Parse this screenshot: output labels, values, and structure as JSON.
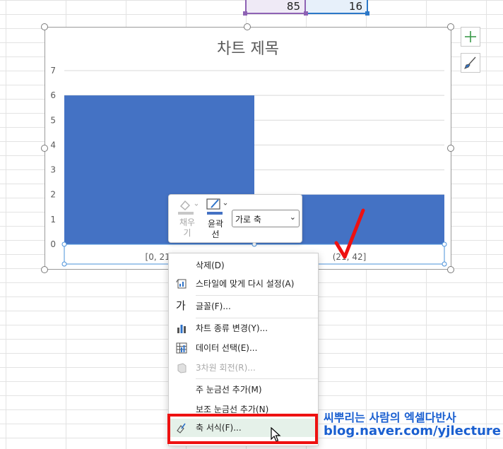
{
  "cells": {
    "a": "85",
    "b": "16"
  },
  "chart": {
    "title": "차트 제목",
    "y_ticks": [
      "0",
      "1",
      "2",
      "3",
      "4",
      "5",
      "6",
      "7"
    ],
    "x_labels": [
      "[0, 21]",
      "(21, 42]"
    ]
  },
  "chart_data": {
    "type": "bar",
    "title": "차트 제목",
    "categories": [
      "[0, 21]",
      "(21, 42]"
    ],
    "values": [
      6,
      2
    ],
    "ylim": [
      0,
      7
    ],
    "grid": true,
    "legend": "none",
    "bar_color": "#4472c4"
  },
  "mini_toolbar": {
    "fill_label": "채우\n기",
    "outline_label": "윤곽\n선",
    "element_select": "가로 축"
  },
  "context_menu": {
    "items": [
      {
        "label": "삭제(D)",
        "icon": "none",
        "enabled": true
      },
      {
        "label": "스타일에 맞게 다시 설정(A)",
        "icon": "reset-style-icon",
        "enabled": true
      },
      {
        "label": "글꼴(F)...",
        "icon": "font-icon",
        "enabled": true
      },
      {
        "label": "차트 종류 변경(Y)...",
        "icon": "chart-type-icon",
        "enabled": true
      },
      {
        "label": "데이터 선택(E)...",
        "icon": "select-data-icon",
        "enabled": true
      },
      {
        "label": "3차원 회전(R)...",
        "icon": "3d-rotation-icon",
        "enabled": false
      },
      {
        "label": "주 눈금선 추가(M)",
        "icon": "none",
        "enabled": true
      },
      {
        "label": "보조 눈금선 추가(N)",
        "icon": "none",
        "enabled": true
      },
      {
        "label": "축 서식(F)...",
        "icon": "format-axis-icon",
        "enabled": true
      }
    ],
    "font_glyph": "가"
  },
  "watermark": {
    "line1": "씨뿌리는 사람의 엑셀다반사",
    "line2": "blog.naver.com/yjlecture"
  },
  "colors": {
    "accent_red": "#ee1111",
    "bar": "#4472c4",
    "watermark": "#1a5fd0"
  }
}
